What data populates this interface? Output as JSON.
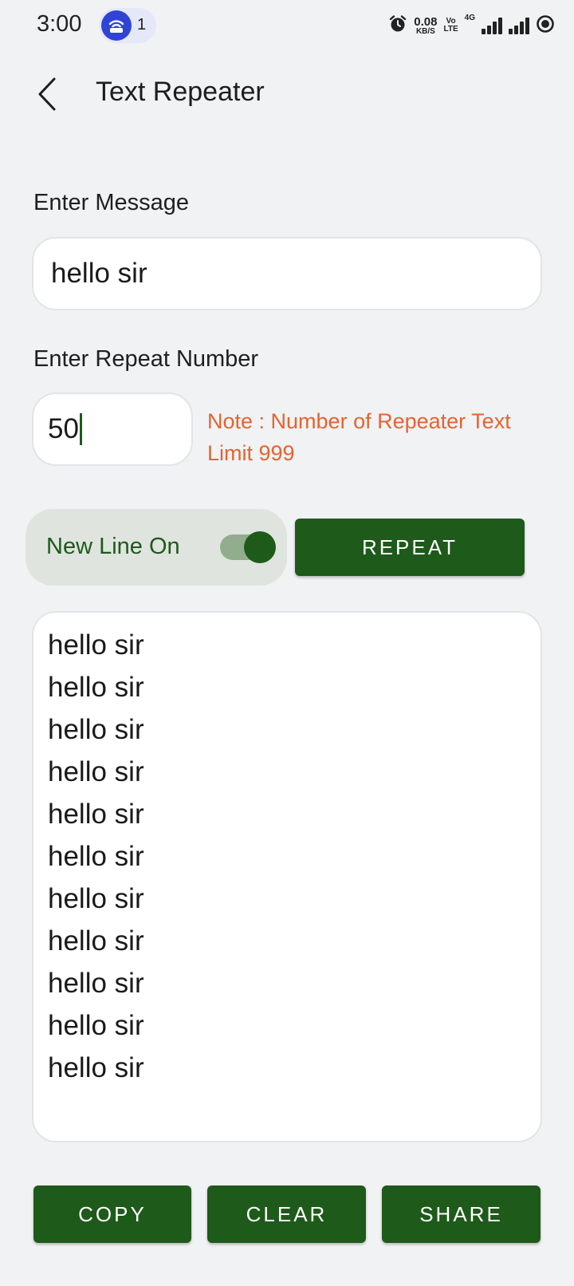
{
  "status_bar": {
    "time": "3:00",
    "hotspot_count": "1",
    "speed_value": "0.08",
    "speed_unit": "KB/S",
    "volte_top": "Vo",
    "volte_bottom": "LTE",
    "network_type": "4G",
    "icons": [
      "hotspot-icon",
      "alarm-icon",
      "signal-icon",
      "signal-icon",
      "ring-icon"
    ]
  },
  "header": {
    "back_icon": "chevron-left-icon",
    "title": "Text Repeater"
  },
  "form": {
    "message_label": "Enter Message",
    "message_value": "hello sir",
    "repeat_label": "Enter Repeat Number",
    "repeat_value": "50",
    "note": "Note : Number of Repeater Text Limit 999"
  },
  "toggle": {
    "label": "New Line On",
    "checked": true
  },
  "actions": {
    "repeat_label": "REPEAT",
    "copy_label": "COPY",
    "clear_label": "CLEAR",
    "share_label": "SHARE"
  },
  "output": {
    "lines": [
      "hello sir",
      "hello sir",
      "hello sir",
      "hello sir",
      "hello sir",
      "hello sir",
      "hello sir",
      "hello sir",
      "hello sir",
      "hello sir",
      "hello sir"
    ]
  },
  "colors": {
    "accent_green": "#1e5a1a",
    "note_orange": "#e6632f",
    "background": "#f1f2f4",
    "hotspot_blue": "#2f44d6"
  }
}
